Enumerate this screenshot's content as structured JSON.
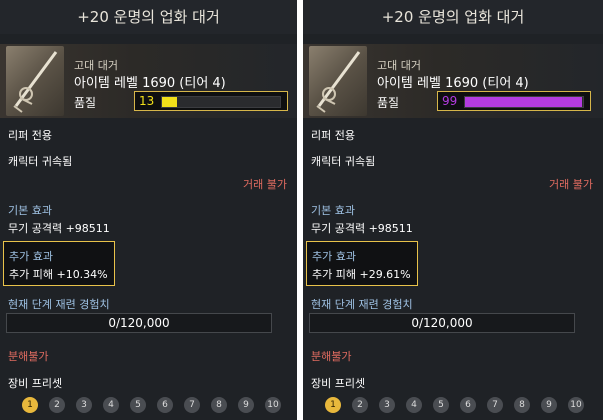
{
  "panels": [
    {
      "title": "+20 운명의 업화 대거",
      "grade": "고대 대거",
      "item_level": "아이템 레벨 1690 (티어 4)",
      "quality_label": "품질",
      "quality_value": "13",
      "quality_fraction": 0.13,
      "quality_color": "#f2e01a",
      "restriction": "리퍼 전용",
      "binding": "캐릭터 귀속됨",
      "trade": "거래 불가",
      "base_effect_label": "기본 효과",
      "base_effect_value": "무기 공격력 +98511",
      "extra_effect_label": "추가 효과",
      "extra_effect_value": "추가 피해 +10.34%",
      "exp_label": "현재 단계 재련 경험치",
      "exp_value": "0/120,000",
      "disassemble": "분해불가",
      "preset_label": "장비 프리셋",
      "presets": [
        "1",
        "2",
        "3",
        "4",
        "5",
        "6",
        "7",
        "8",
        "9",
        "10"
      ]
    },
    {
      "title": "+20 운명의 업화 대거",
      "grade": "고대 대거",
      "item_level": "아이템 레벨 1690 (티어 4)",
      "quality_label": "품질",
      "quality_value": "99",
      "quality_fraction": 0.99,
      "quality_color": "#b33ce0",
      "restriction": "리퍼 전용",
      "binding": "캐릭터 귀속됨",
      "trade": "거래 불가",
      "base_effect_label": "기본 효과",
      "base_effect_value": "무기 공격력 +98511",
      "extra_effect_label": "추가 효과",
      "extra_effect_value": "추가 피해 +29.61%",
      "exp_label": "현재 단계 재련 경험치",
      "exp_value": "0/120,000",
      "disassemble": "분해불가",
      "preset_label": "장비 프리셋",
      "presets": [
        "1",
        "2",
        "3",
        "4",
        "5",
        "6",
        "7",
        "8",
        "9",
        "10"
      ]
    }
  ],
  "colors": {
    "panel_bg": "#1f2226",
    "accent_gold": "#e8c24a",
    "label_blue": "#9ec0e2",
    "warn_red": "#e06b60"
  },
  "icons": {
    "item": "dagger-icon",
    "preset": "preset-number-badge"
  }
}
